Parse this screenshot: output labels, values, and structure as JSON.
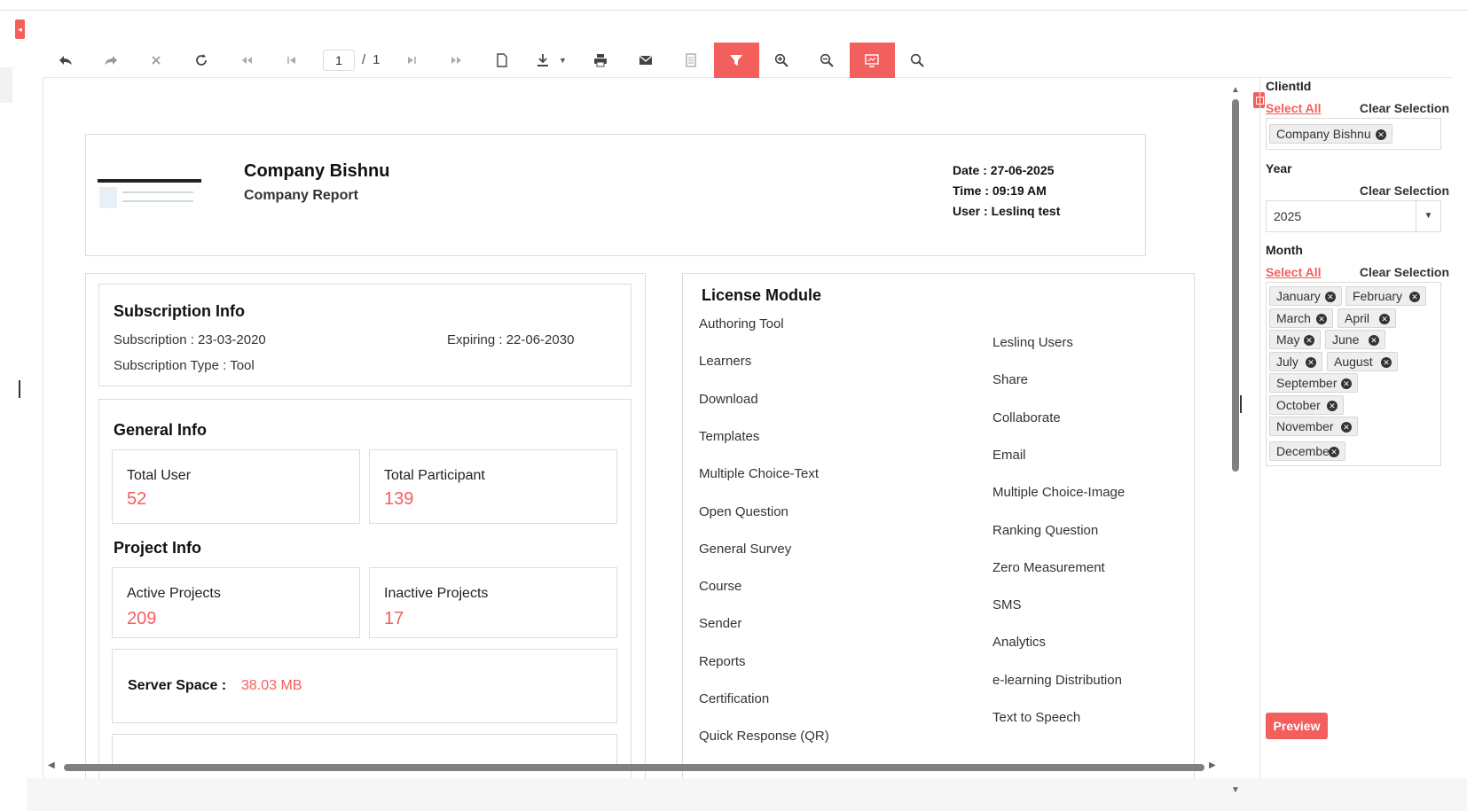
{
  "toolbar": {
    "page_current": "1",
    "page_separator": "/",
    "page_total": "1",
    "highlight_color": "#f25f5c"
  },
  "report": {
    "company_name": "Company Bishnu",
    "report_title": "Company Report",
    "date": "Date : 27-06-2025",
    "time": "Time : 09:19 AM",
    "user": "User : Leslinq test",
    "subscription": {
      "title": "Subscription Info",
      "start": "Subscription : 23-03-2020",
      "expiring": "Expiring : 22-06-2030",
      "type": "Subscription Type : Tool"
    },
    "general": {
      "title": "General Info",
      "total_user_label": "Total User",
      "total_user_value": "52",
      "total_participant_label": "Total Participant",
      "total_participant_value": "139"
    },
    "project": {
      "title": "Project Info",
      "active_label": "Active Projects",
      "active_value": "209",
      "inactive_label": "Inactive Projects",
      "inactive_value": "17"
    },
    "server": {
      "label": "Server Space :",
      "value": "38.03 MB"
    },
    "license": {
      "title": "License Module",
      "left_items": [
        "Authoring Tool",
        "Learners",
        "Download",
        "Templates",
        "Multiple Choice-Text",
        "Open Question",
        "General Survey",
        "Course",
        "Sender",
        "Reports",
        "Certification",
        "Quick Response (QR)"
      ],
      "right_items": [
        "Leslinq Users",
        "Share",
        "Collaborate",
        "Email",
        "Multiple Choice-Image",
        "Ranking Question",
        "Zero Measurement",
        "SMS",
        "Analytics",
        "e-learning Distribution",
        "Text to Speech"
      ]
    }
  },
  "parameters": {
    "client": {
      "label": "ClientId",
      "select_all": "Select All",
      "clear": "Clear Selection",
      "chips": [
        "Company Bishnu"
      ]
    },
    "year": {
      "label": "Year",
      "clear": "Clear Selection",
      "value": "2025"
    },
    "month": {
      "label": "Month",
      "select_all": "Select All",
      "clear": "Clear Selection",
      "chips": [
        "January",
        "February",
        "March",
        "April",
        "May",
        "June",
        "July",
        "August",
        "September",
        "October",
        "November",
        "December"
      ]
    },
    "preview_label": "Preview"
  }
}
